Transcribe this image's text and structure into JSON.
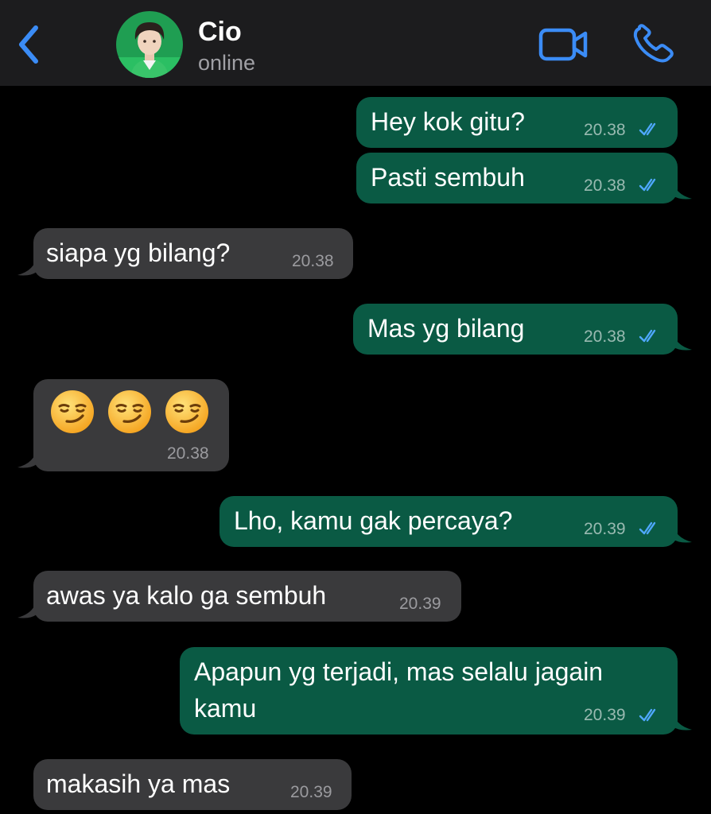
{
  "header": {
    "contact_name": "Cio",
    "contact_status": "online",
    "back_icon": "chevron-left-icon",
    "video_icon": "video-camera-icon",
    "call_icon": "phone-icon",
    "accent_color": "#3b8cf6"
  },
  "messages": [
    {
      "direction": "outgoing",
      "text": "Hey kok gitu?",
      "time": "20.38",
      "read": true
    },
    {
      "direction": "outgoing",
      "text": "Pasti sembuh",
      "time": "20.38",
      "read": true
    },
    {
      "direction": "incoming",
      "text": "siapa yg bilang?",
      "time": "20.38"
    },
    {
      "direction": "outgoing",
      "text": "Mas yg bilang",
      "time": "20.38",
      "read": true
    },
    {
      "direction": "incoming",
      "text": "😏 😏 😏",
      "emoji": "smirking-face",
      "emoji_count": 3,
      "time": "20.38"
    },
    {
      "direction": "outgoing",
      "text": "Lho, kamu gak percaya?",
      "time": "20.39",
      "read": true
    },
    {
      "direction": "incoming",
      "text": "awas ya kalo ga sembuh",
      "time": "20.39"
    },
    {
      "direction": "outgoing",
      "text_line1": "Apapun yg terjadi, mas selalu jagain",
      "text_line2": "kamu",
      "time": "20.39",
      "read": true
    },
    {
      "direction": "incoming",
      "text": "makasih ya mas",
      "time": "20.39"
    }
  ],
  "colors": {
    "outgoing_bubble": "#0a5a44",
    "incoming_bubble": "#3a3a3c",
    "read_ticks": "#4fa8ff"
  }
}
